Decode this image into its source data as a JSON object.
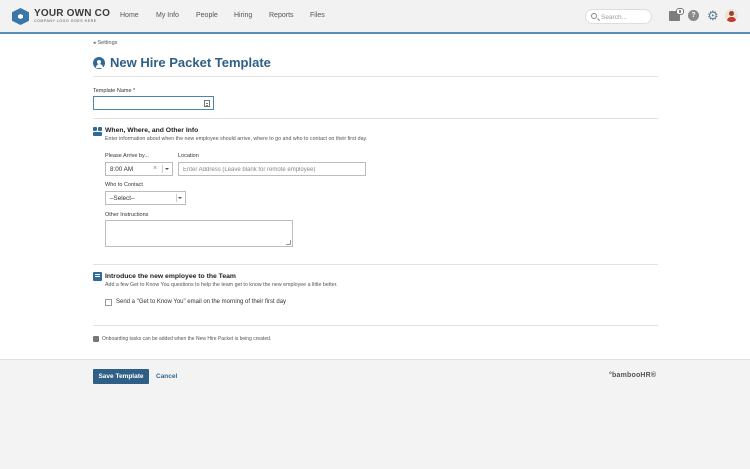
{
  "header": {
    "logo_name": "YOUR OWN CO",
    "logo_tagline": "COMPANY LOGO GOES HERE",
    "nav": [
      {
        "label": "Home"
      },
      {
        "label": "My Info"
      },
      {
        "label": "People"
      },
      {
        "label": "Hiring"
      },
      {
        "label": "Reports"
      },
      {
        "label": "Files"
      }
    ],
    "search_placeholder": "Search...",
    "inbox_count": "0",
    "help_glyph": "?"
  },
  "breadcrumb": {
    "label": "Settings"
  },
  "page": {
    "title": "New Hire Packet Template",
    "template_name_label": "Template Name *",
    "template_name_value": ""
  },
  "section_when": {
    "title": "When, Where, and Other Info",
    "description": "Enter information about when the new employee should arrive, where to go and who to contact on their first day.",
    "arrive_label": "Please Arrive by...",
    "arrive_value": "8:00 AM",
    "location_label": "Location",
    "location_placeholder": "Enter Address (Leave blank for remote employee)",
    "contact_label": "Who to Contact",
    "contact_value": "–Select–",
    "instructions_label": "Other Instructions"
  },
  "section_team": {
    "title": "Introduce the new employee to the Team",
    "description": "Add a few Get to Know You questions to help the team get to know the new employee a little better.",
    "checkbox_label": "Send a \"Get to Know You\" email on the morning of their first day",
    "checkbox_checked": false
  },
  "note": "Onboarding tasks can be added when the New Hire Packet is being created.",
  "footer": {
    "save_label": "Save Template",
    "cancel_label": "Cancel",
    "brand": "°bambooHR®"
  },
  "colors": {
    "accent": "#2f5f86",
    "nav_border": "#5b8fb8"
  }
}
